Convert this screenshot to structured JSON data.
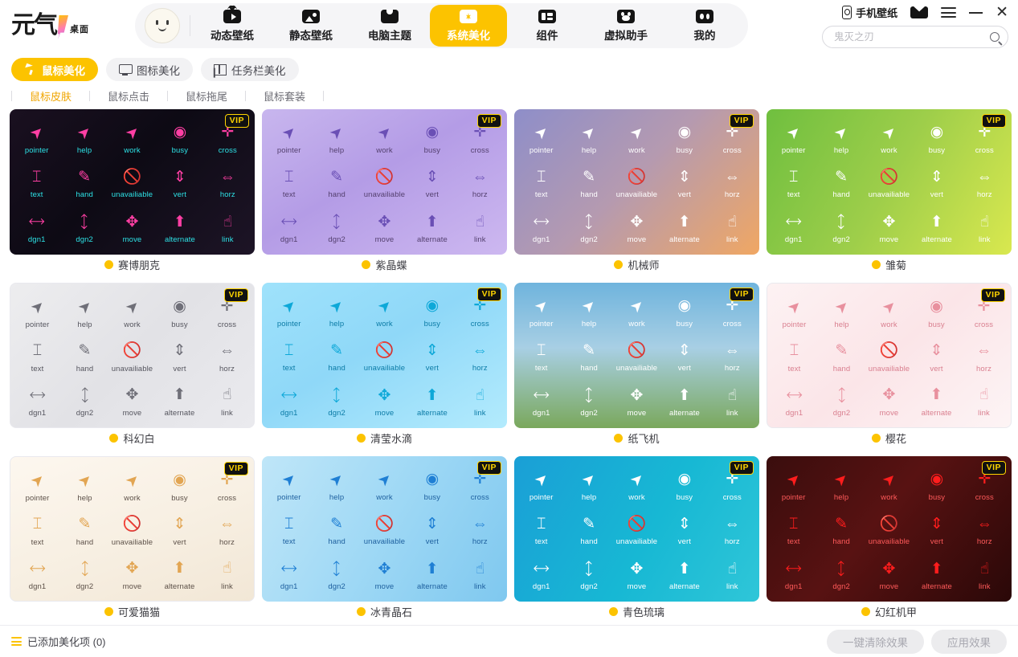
{
  "app": {
    "logo_text": "元气",
    "logo_sub": "桌面"
  },
  "nav": {
    "items": [
      {
        "label": "动态壁纸",
        "icon": "dynamic-wallpaper-icon",
        "active": false
      },
      {
        "label": "静态壁纸",
        "icon": "static-wallpaper-icon",
        "active": false
      },
      {
        "label": "电脑主题",
        "icon": "pc-theme-icon",
        "active": false
      },
      {
        "label": "系统美化",
        "icon": "system-beautify-icon",
        "active": true
      },
      {
        "label": "组件",
        "icon": "widget-icon",
        "active": false
      },
      {
        "label": "虚拟助手",
        "icon": "virtual-assistant-icon",
        "active": false
      },
      {
        "label": "我的",
        "icon": "mine-icon",
        "active": false
      }
    ]
  },
  "topright": {
    "phone_wallpaper": "手机壁纸",
    "mail_icon": "mail-icon",
    "menu_icon": "hamburger-menu-icon",
    "minimize_icon": "minimize-icon",
    "close_icon": "close-icon",
    "close_glyph": "✕"
  },
  "search": {
    "value": "",
    "placeholder": "鬼灭之刃",
    "icon": "search-icon"
  },
  "category_tabs": [
    {
      "label": "鼠标美化",
      "icon": "cursor-icon",
      "active": true
    },
    {
      "label": "图标美化",
      "icon": "monitor-icon",
      "active": false
    },
    {
      "label": "任务栏美化",
      "icon": "taskbar-grid-icon",
      "active": false
    }
  ],
  "sub_tabs": [
    {
      "label": "鼠标皮肤",
      "active": true
    },
    {
      "label": "鼠标点击",
      "active": false
    },
    {
      "label": "鼠标拖尾",
      "active": false
    },
    {
      "label": "鼠标套装",
      "active": false
    }
  ],
  "cursor_names": [
    "pointer",
    "help",
    "work",
    "busy",
    "cross",
    "text",
    "hand",
    "unavailiable",
    "vert",
    "horz",
    "dgn1",
    "dgn2",
    "move",
    "alternate",
    "link"
  ],
  "colors": {
    "accent": "#fcc300",
    "active_tab_text": "#f0a500",
    "vip_bg": "#111111",
    "vip_text": "#ffd400",
    "dot": "#fcc300"
  },
  "vip_label": "VIP",
  "cards": [
    {
      "title": "赛博朋克",
      "vip": true,
      "bg": "linear-gradient(135deg,#1a1020 0%,#0d0a14 45%,#1d1426 100%)",
      "glyph_color": "#ff3fa4",
      "label_color": "#2de2e6",
      "bordered": false
    },
    {
      "title": "紫晶蝶",
      "vip": true,
      "bg": "linear-gradient(150deg,#c8b6ee 0%,#b49ce6 45%,#cdb8f0 100%)",
      "glyph_color": "#6a4fb5",
      "label_color": "#54406f",
      "bordered": false
    },
    {
      "title": "机械师",
      "vip": true,
      "bg": "linear-gradient(135deg,#8e8ec9 0%,#b59ab0 48%,#f0a763 100%)",
      "glyph_color": "#ffffff",
      "label_color": "#ffffff",
      "bordered": false
    },
    {
      "title": "雏菊",
      "vip": true,
      "bg": "linear-gradient(120deg,#6fbf3f 0%,#9ece4a 50%,#d9e84f 100%)",
      "glyph_color": "#ffffff",
      "label_color": "#ffffff",
      "bordered": false
    },
    {
      "title": "科幻白",
      "vip": true,
      "bg": "linear-gradient(135deg,#ededef 0%,#e2e2e6 50%,#eaeaee 100%)",
      "glyph_color": "#6f6f78",
      "label_color": "#55555e",
      "bordered": true
    },
    {
      "title": "清莹水滴",
      "vip": true,
      "bg": "linear-gradient(150deg,#9fe2fb 0%,#8fd8f8 45%,#b3ebfd 100%)",
      "glyph_color": "#0da8d8",
      "label_color": "#0b7ba6",
      "bordered": false
    },
    {
      "title": "纸飞机",
      "vip": true,
      "bg": "linear-gradient(180deg,#6fb4dd 0%,#a8cfe4 45%,#7aa85c 100%)",
      "glyph_color": "#ffffff",
      "label_color": "#ffffff",
      "bordered": false
    },
    {
      "title": "樱花",
      "vip": true,
      "bg": "linear-gradient(140deg,#fdf2f3 0%,#fbe5e8 50%,#fdf4f5 100%)",
      "glyph_color": "#e8909e",
      "label_color": "#d97f8f",
      "bordered": true
    },
    {
      "title": "可爱猫猫",
      "vip": true,
      "bg": "linear-gradient(160deg,#fdf7ef 0%,#f7efe2 55%,#f2e7d6 100%)",
      "glyph_color": "#e2a552",
      "label_color": "#5c5048",
      "bordered": true
    },
    {
      "title": "冰青晶石",
      "vip": true,
      "bg": "linear-gradient(120deg,#bfe6f8 0%,#9ed8f5 50%,#7fc8ef 100%)",
      "glyph_color": "#1f7fd4",
      "label_color": "#1d5f9e",
      "bordered": false
    },
    {
      "title": "青色琉璃",
      "vip": true,
      "bg": "linear-gradient(120deg,#1a9fd6 0%,#17b8d4 55%,#2fc6d8 100%)",
      "glyph_color": "#ffffff",
      "label_color": "#ffffff",
      "bordered": false
    },
    {
      "title": "幻红机甲",
      "vip": true,
      "bg": "linear-gradient(130deg,#3a0d0d 0%,#581212 45%,#2a0808 100%)",
      "glyph_color": "#ff1d1d",
      "label_color": "#ff5a5a",
      "bordered": false
    }
  ],
  "bottom": {
    "added_label": "已添加美化项 (0)",
    "clear_button": "一键清除效果",
    "apply_button": "应用效果"
  }
}
